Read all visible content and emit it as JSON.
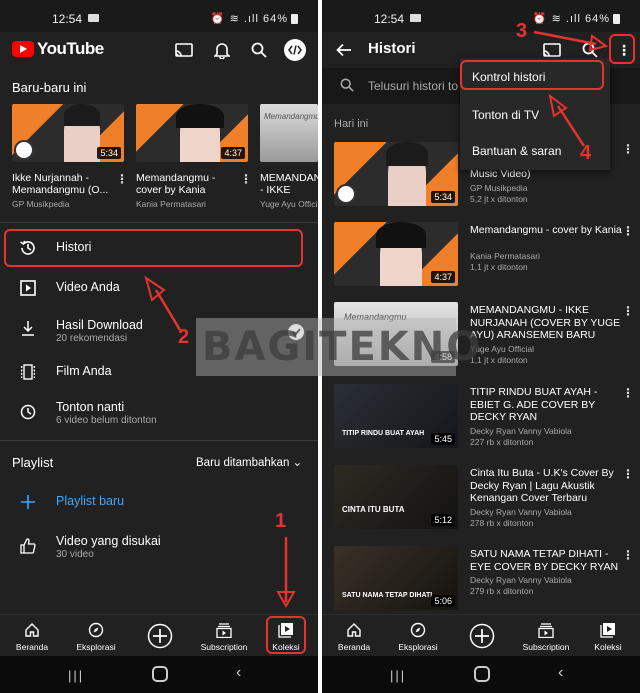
{
  "left": {
    "status": {
      "time": "12:54",
      "battery": "64%"
    },
    "app_bar": {
      "brand": "YouTube"
    },
    "recent": {
      "title": "Baru-baru ini",
      "items": [
        {
          "title": "Ikke Nurjannah - Memandangmu (O...",
          "channel": "GP Musikpedia",
          "duration": "5:34"
        },
        {
          "title": "Memandangmu - cover by Kania",
          "channel": "Kania Permatasari",
          "duration": "4:37"
        },
        {
          "title": "MEMANDAN - IKKE NURJA",
          "channel": "Yuge Ayu Offici",
          "duration": ""
        }
      ]
    },
    "library": [
      {
        "label": "Histori",
        "sub": "",
        "icon": "history-icon"
      },
      {
        "label": "Video Anda",
        "sub": "",
        "icon": "play-box-icon"
      },
      {
        "label": "Hasil Download",
        "sub": "20 rekomendasi",
        "icon": "download-icon"
      },
      {
        "label": "Film Anda",
        "sub": "",
        "icon": "film-icon"
      },
      {
        "label": "Tonton nanti",
        "sub": "6 video belum ditonton",
        "icon": "clock-icon"
      }
    ],
    "playlist": {
      "title": "Playlist",
      "sort": "Baru ditambahkan",
      "new_label": "Playlist baru",
      "liked_label": "Video yang disukai",
      "liked_sub": "30 video"
    },
    "nav": [
      "Beranda",
      "Eksplorasi",
      "",
      "Subscription",
      "Koleksi"
    ]
  },
  "right": {
    "status": {
      "time": "12:54",
      "battery": "64%"
    },
    "header_title": "Histori",
    "search_placeholder": "Telusuri histori to",
    "today_label": "Hari ini",
    "menu": [
      "Kontrol histori",
      "Tonton di TV",
      "Bantuan & saran"
    ],
    "history": [
      {
        "title": "Music Video)",
        "channel": "GP Musikpedia",
        "views": "5,2 jt x ditonton",
        "duration": "5:34",
        "thumb": "orange-girl"
      },
      {
        "title": "Memandangmu - cover by Kania",
        "channel": "Kania Permatasari",
        "views": "1,1 jt x ditonton",
        "duration": "4:37",
        "thumb": "orange-girl"
      },
      {
        "title": "MEMANDANGMU - IKKE NURJANAH (COVER BY YUGE AYU) ARANSEMEN BARU",
        "channel": "Yuge Ayu Official",
        "views": "1,1 jt x ditonton",
        "duration": "4:58",
        "thumb": "white"
      },
      {
        "title": "TITIP RINDU BUAT AYAH - EBIET G. ADE COVER BY DECKY RYAN",
        "channel": "Decky Ryan Vanny Vabiola",
        "views": "227 rb x ditonton",
        "duration": "5:45",
        "thumb": "dark",
        "overlay": "TITIP RINDU BUAT AYAH"
      },
      {
        "title": "Cinta Itu Buta - U.K's Cover By Decky Ryan | Lagu Akustik Kenangan Cover Terbaru",
        "channel": "Decky Ryan Vanny Vabiola",
        "views": "278 rb x ditonton",
        "duration": "5:12",
        "thumb": "dark",
        "overlay": "CINTA ITU BUTA"
      },
      {
        "title": "SATU NAMA TETAP DIHATI - EYE COVER BY DECKY RYAN",
        "channel": "Decky Ryan Vanny Vabiola",
        "views": "279 rb x ditonton",
        "duration": "5:06",
        "thumb": "dark",
        "overlay": "SATU NAMA TETAP DIHATI"
      }
    ],
    "nav": [
      "Beranda",
      "Eksplorasi",
      "",
      "Subscription",
      "Koleksi"
    ]
  },
  "annotations": {
    "step1": "1",
    "step2": "2",
    "step3": "3",
    "step4": "4",
    "watermark": "BAGITEKNO"
  },
  "colors": {
    "accent_red": "#e3342f",
    "bg_dark": "#212121",
    "link_blue": "#3ea6ff"
  }
}
